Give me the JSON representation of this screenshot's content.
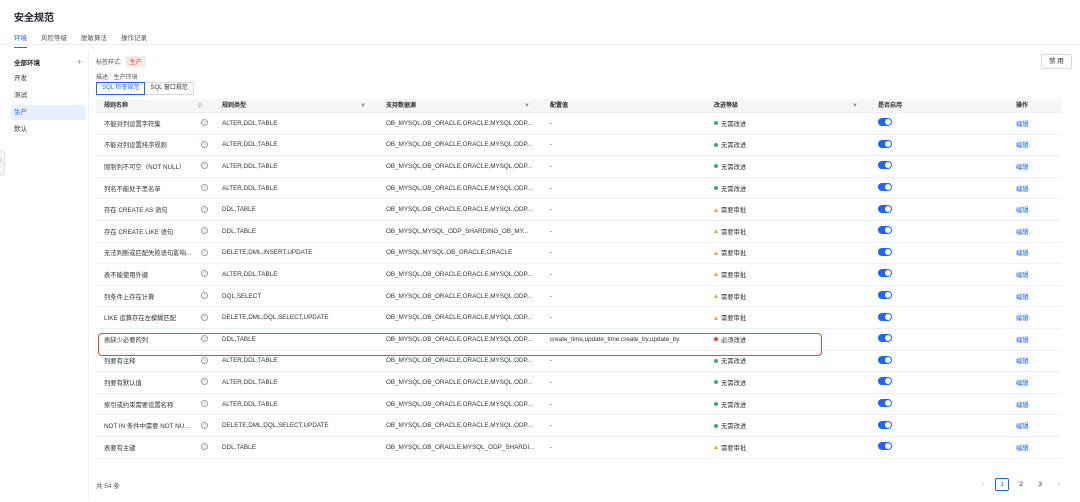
{
  "page": {
    "title": "安全规范"
  },
  "top_tabs": [
    {
      "label": "环境",
      "active": true
    },
    {
      "label": "风险等级",
      "active": false
    },
    {
      "label": "脱敏算法",
      "active": false
    },
    {
      "label": "操作记录",
      "active": false
    }
  ],
  "sidebar": {
    "header_label": "全部环境",
    "add_icon": "plus-icon",
    "items": [
      {
        "label": "开发",
        "active": false
      },
      {
        "label": "测试",
        "active": false
      },
      {
        "label": "生产",
        "active": true
      },
      {
        "label": "默认",
        "active": false
      }
    ]
  },
  "env_meta": {
    "tag_style_label": "标签样式:",
    "tag_value": "生产",
    "desc_label": "描述:",
    "desc_value": "生产环境",
    "disable_button": "禁 用"
  },
  "sub_tabs": [
    {
      "label": "SQL 检查规范",
      "active": true
    },
    {
      "label": "SQL 窗口规范",
      "active": false
    }
  ],
  "table": {
    "headers": {
      "name": "规则名称",
      "rule_type": "规则类型",
      "datasource": "支持数据源",
      "config": "配置值",
      "level": "改进等级",
      "enabled": "是否启用",
      "action": "操作"
    },
    "filter_icons": [
      "search-icon",
      "filter-icon"
    ],
    "rows": [
      {
        "name": "不能对列设置字符集",
        "rule_type": "ALTER,DDL,TABLE",
        "datasource": "OB_MYSQL,OB_ORACLE,ORACLE,MYSQL,ODP...",
        "config": "-",
        "level": "无需改进",
        "level_kind": "green",
        "action": "编辑"
      },
      {
        "name": "不能对列设置排序规则",
        "rule_type": "ALTER,DDL,TABLE",
        "datasource": "OB_MYSQL,OB_ORACLE,ORACLE,MYSQL,ODP...",
        "config": "-",
        "level": "无需改进",
        "level_kind": "green",
        "action": "编辑"
      },
      {
        "name": "限制列不可空（NOT NULL）",
        "rule_type": "ALTER,DDL,TABLE",
        "datasource": "OB_MYSQL,OB_ORACLE,ORACLE,MYSQL,ODP...",
        "config": "-",
        "level": "无需改进",
        "level_kind": "green",
        "action": "编辑"
      },
      {
        "name": "列名不能处于黑名单",
        "rule_type": "ALTER,DDL,TABLE",
        "datasource": "OB_MYSQL,OB_ORACLE,ORACLE,MYSQL,ODP...",
        "config": "-",
        "level": "无需改进",
        "level_kind": "green",
        "action": "编辑"
      },
      {
        "name": "存在 CREATE AS 语句",
        "rule_type": "DDL,TABLE",
        "datasource": "OB_MYSQL,OB_ORACLE,ORACLE,MYSQL,ODP...",
        "config": "-",
        "level": "需要审批",
        "level_kind": "orange",
        "action": "编辑"
      },
      {
        "name": "存在 CREATE LIKE 语句",
        "rule_type": "DDL,TABLE",
        "datasource": "OB_MYSQL,MYSQL_ODP_SHARDING_OB_MY...",
        "config": "-",
        "level": "需要审批",
        "level_kind": "orange",
        "action": "编辑"
      },
      {
        "name": "无法判断或匹配失败语句影响...",
        "rule_type": "DELETE,DML,INSERT,UPDATE",
        "datasource": "OB_MYSQL,MYSQL,OB_ORACLE,ORACLE",
        "config": "-",
        "level": "需要审批",
        "level_kind": "orange",
        "action": "编辑"
      },
      {
        "name": "表不能使用外键",
        "rule_type": "ALTER,DDL,TABLE",
        "datasource": "OB_MYSQL,OB_ORACLE,ORACLE,MYSQL,ODP...",
        "config": "-",
        "level": "需要审批",
        "level_kind": "orange",
        "action": "编辑"
      },
      {
        "name": "列条件上存在计算",
        "rule_type": "DQL,SELECT",
        "datasource": "OB_MYSQL,OB_ORACLE,ORACLE,MYSQL,ODP...",
        "config": "-",
        "level": "需要审批",
        "level_kind": "orange",
        "action": "编辑"
      },
      {
        "name": "LIKE 运算存在左模糊匹配",
        "rule_type": "DELETE,DML,DQL,SELECT,UPDATE",
        "datasource": "OB_MYSQL,OB_ORACLE,ORACLE,MYSQL,ODP...",
        "config": "-",
        "level": "需要审批",
        "level_kind": "orange",
        "action": "编辑"
      },
      {
        "name": "表缺少必要的列",
        "rule_type": "DDL,TABLE",
        "datasource": "OB_MYSQL,OB_ORACLE,ORACLE,MYSQL,ODP...",
        "config": "create_time,update_time,create_by,update_by",
        "level": "必须改进",
        "level_kind": "red",
        "action": "编辑"
      },
      {
        "name": "列要有注释",
        "rule_type": "ALTER,DDL,TABLE",
        "datasource": "OB_MYSQL,OB_ORACLE,ORACLE,MYSQL,ODP...",
        "config": "-",
        "level": "无需改进",
        "level_kind": "green",
        "action": "编辑"
      },
      {
        "name": "列要有默认值",
        "rule_type": "ALTER,DDL,TABLE",
        "datasource": "OB_MYSQL,OB_ORACLE,ORACLE,MYSQL,ODP...",
        "config": "-",
        "level": "无需改进",
        "level_kind": "green",
        "action": "编辑"
      },
      {
        "name": "索引或约束需要设置名称",
        "rule_type": "ALTER,DDL,TABLE",
        "datasource": "OB_MYSQL,OB_ORACLE,ORACLE,MYSQL,ODP...",
        "config": "-",
        "level": "无需改进",
        "level_kind": "green",
        "action": "编辑"
      },
      {
        "name": "NOT IN 条件中需要 NOT NU...",
        "rule_type": "DELETE,DML,DQL,SELECT,UPDATE",
        "datasource": "OB_MYSQL,OB_ORACLE,ORACLE,MYSQL,ODP...",
        "config": "-",
        "level": "无需改进",
        "level_kind": "green",
        "action": "编辑"
      },
      {
        "name": "表要有主键",
        "rule_type": "DDL,TABLE",
        "datasource": "OB_MYSQL,OB_ORACLE,MYSQL_ODP_SHARDI...",
        "config": "-",
        "level": "需要审批",
        "level_kind": "orange",
        "action": "编辑"
      }
    ]
  },
  "footer": {
    "total": "共 54 条",
    "pages": [
      "1",
      "2",
      "3"
    ],
    "current_page": "1"
  },
  "colors": {
    "accent": "#1a66ff",
    "green": "#2fb36a",
    "orange": "#f5a623",
    "red": "#e5463a"
  }
}
